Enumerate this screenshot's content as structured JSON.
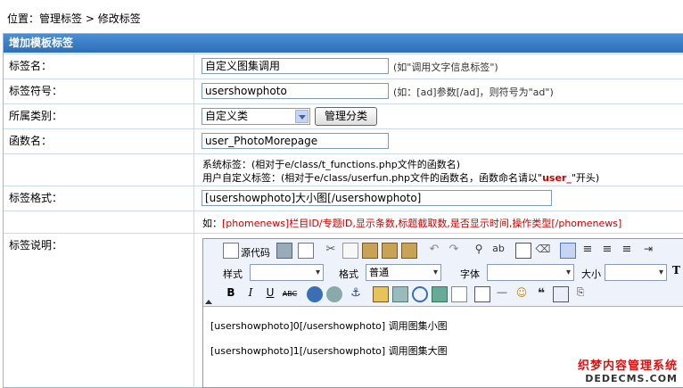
{
  "breadcrumb": {
    "prefix": "位置：",
    "link": "管理标签",
    "sep": " > ",
    "current": "修改标签"
  },
  "panel": {
    "title": "增加模板标签"
  },
  "fields": {
    "name": {
      "label": "标签名：",
      "value": "自定义图集调用",
      "hint": "(如\"调用文字信息标签\")"
    },
    "symbol": {
      "label": "标签符号：",
      "value": "usershowphoto",
      "hint": "(如：[ad]参数[/ad]，则符号为\"ad\")"
    },
    "category": {
      "label": "所属类别：",
      "selected": "自定义类",
      "button": "管理分类"
    },
    "func": {
      "label": "函数名：",
      "value": "user_PhotoMorepage",
      "note1": "系统标签：(相对于e/class/t_functions.php文件的函数名)",
      "note2_pre": "用户自定义标签：(相对于e/class/userfun.php文件的函数名，函数命名请以\"",
      "note2_red": "user_",
      "note2_post": "\"开头)"
    },
    "format": {
      "label": "标签格式：",
      "value": "[usershowphoto]大小图[/usershowphoto]",
      "example_pre": "如：",
      "example_red": "[phomenews]栏目ID/专题ID,显示条数,标题截取数,是否显示时间,操作类型[/phomenews]"
    },
    "desc": {
      "label": "标签说明：",
      "toolbar": {
        "source": "源代码",
        "style": "样式",
        "format": "格式",
        "format_value": "普通",
        "font": "字体",
        "size": "大小"
      },
      "lines": [
        "[usershowphoto]0[/usershowphoto]  调用图集小图",
        "[usershowphoto]1[/usershowphoto] 调用图集大图"
      ]
    }
  },
  "watermark": {
    "line1": "织梦内容管理系统",
    "line2": "DEDECMS.COM"
  }
}
